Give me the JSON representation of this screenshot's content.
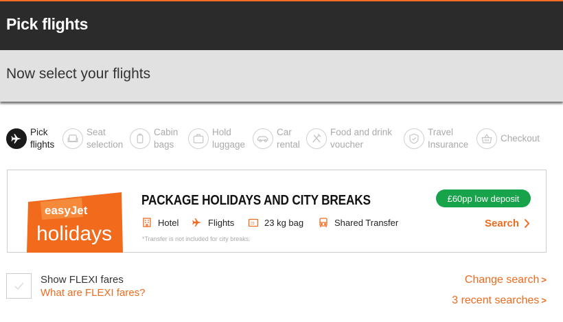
{
  "header": {
    "title": "Pick flights"
  },
  "subheader": {
    "title": "Now select your flights"
  },
  "steps": [
    {
      "label": "Pick\nflights",
      "icon": "plane-icon",
      "active": true
    },
    {
      "label": "Seat\nselection",
      "icon": "seat-icon",
      "active": false
    },
    {
      "label": "Cabin\nbags",
      "icon": "cabin-bag-icon",
      "active": false
    },
    {
      "label": "Hold\nluggage",
      "icon": "luggage-icon",
      "active": false
    },
    {
      "label": "Car\nrental",
      "icon": "car-icon",
      "active": false
    },
    {
      "label": "Food and drink\nvoucher",
      "icon": "cutlery-icon",
      "active": false
    },
    {
      "label": "Travel\nInsurance",
      "icon": "shield-icon",
      "active": false
    },
    {
      "label": "Checkout",
      "icon": "basket-icon",
      "active": false
    }
  ],
  "promo": {
    "logo_brand": "easyJet",
    "logo_product": "holidays",
    "title": "PACKAGE HOLIDAYS AND CITY BREAKS",
    "features": [
      "Hotel",
      "Flights",
      "23 kg bag",
      "Shared Transfer"
    ],
    "note": "*Transfer is not included for city breaks.",
    "deposit_badge": "£60pp low deposit",
    "search_label": "Search"
  },
  "flexi": {
    "label": "Show FLEXI fares",
    "link": "What are FLEXI fares?"
  },
  "links": {
    "change_search": "Change search",
    "recent_searches": "3 recent searches"
  },
  "colors": {
    "accent": "#ee6a1f",
    "header_bg": "#2b2b2b",
    "subheader_bg": "#e1e1e1",
    "deposit_green": "#16a34a"
  }
}
